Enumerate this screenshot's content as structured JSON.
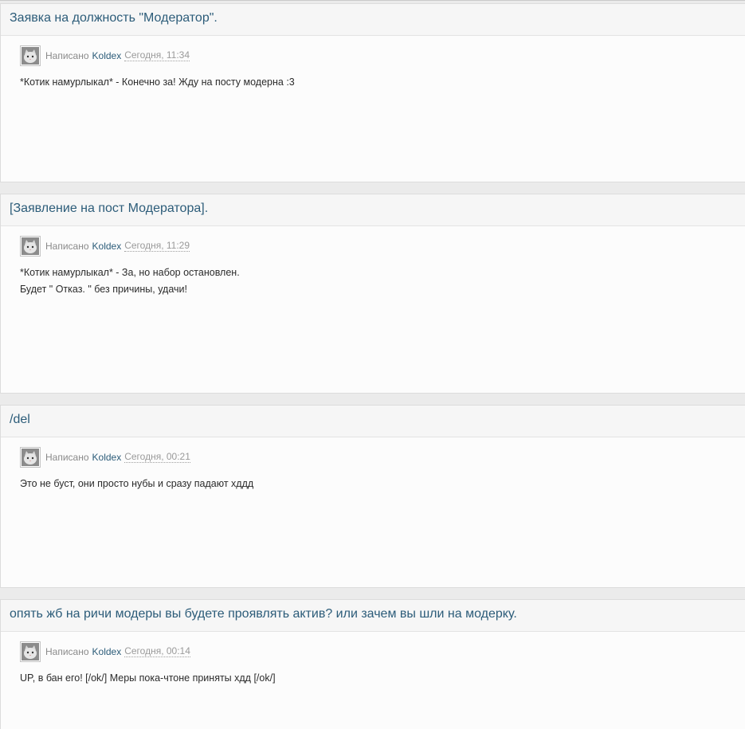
{
  "posts": [
    {
      "title": "Заявка на должность \"Модератор\".",
      "written_label": "Написано",
      "author": "Koldex",
      "date": "Сегодня, 11:34",
      "lines": [
        "*Котик намурлыкал* - Конечно за! Жду на посту модерна :3"
      ]
    },
    {
      "title": "[Заявление на пост Модератора].",
      "written_label": "Написано",
      "author": "Koldex",
      "date": "Сегодня, 11:29",
      "lines": [
        "*Котик намурлыкал* - За, но набор остановлен.",
        "Будет \" Отказ. \" без причины, удачи!"
      ]
    },
    {
      "title": "/del",
      "written_label": "Написано",
      "author": "Koldex",
      "date": "Сегодня, 00:21",
      "lines": [
        "Это не буст, они просто нубы и сразу падают хддд"
      ]
    },
    {
      "title": "опять жб на ричи модеры вы будете проявлять актив? или зачем вы шли на модерку.",
      "written_label": "Написано",
      "author": "Koldex",
      "date": "Сегодня, 00:14",
      "lines": [
        "UP, в бан его! [/ok/] Меры пока-чтоне приняты хдд [/ok/]"
      ]
    }
  ],
  "colors": {
    "title_link": "#2c5c79",
    "author_link": "#2c5c79",
    "meta_text": "#8a8a8a",
    "body_text": "#2b2b2b"
  }
}
